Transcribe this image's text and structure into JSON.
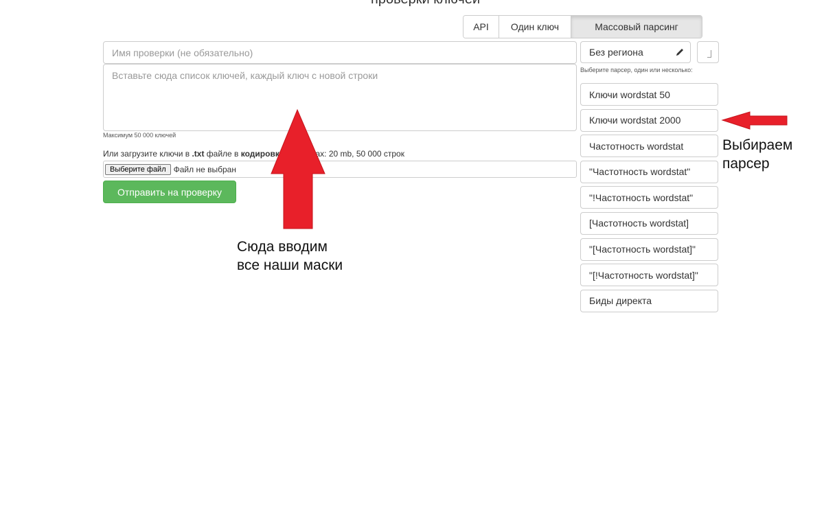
{
  "page": {
    "top_title": "проверки ключей"
  },
  "tabs": [
    {
      "label": "API"
    },
    {
      "label": "Один ключ"
    },
    {
      "label": "Массовый парсинг"
    }
  ],
  "form": {
    "name_placeholder": "Имя проверки (не обязательно)",
    "keys_placeholder": "Вставьте сюда список ключей, каждый ключ с новой строки",
    "max_note": "Максимум 50 000 ключей",
    "upload_prefix": "Или загрузите ключи в ",
    "upload_ext": ".txt",
    "upload_middle": " файле в ",
    "upload_encoding_label": "кодировке utf-8",
    "upload_suffix": ", max: 20 mb, 50 000 строк",
    "file_button": "Выберите файл",
    "file_status": "Файл не выбран",
    "submit": "Отправить на проверку"
  },
  "region": {
    "value": "Без региона"
  },
  "parser_hint": "Выберите парсер, один или несколько:",
  "parsers": [
    {
      "label": "Ключи wordstat 50"
    },
    {
      "label": "Ключи wordstat 2000"
    },
    {
      "label": "Частотность wordstat"
    },
    {
      "label": "\"Частотность wordstat\""
    },
    {
      "label": "\"!Частотность wordstat\""
    },
    {
      "label": "[Частотность wordstat]"
    },
    {
      "label": "\"[Частотность wordstat]\""
    },
    {
      "label": "\"[!Частотность wordstat]\""
    },
    {
      "label": "Биды директа"
    }
  ],
  "annotations": {
    "left_line1": "Сюда вводим",
    "left_line2": "все наши маски",
    "right_line1": "Выбираем",
    "right_line2": "парсер"
  },
  "colors": {
    "submit_bg": "#5cb85c",
    "arrow": "#e8202a"
  }
}
